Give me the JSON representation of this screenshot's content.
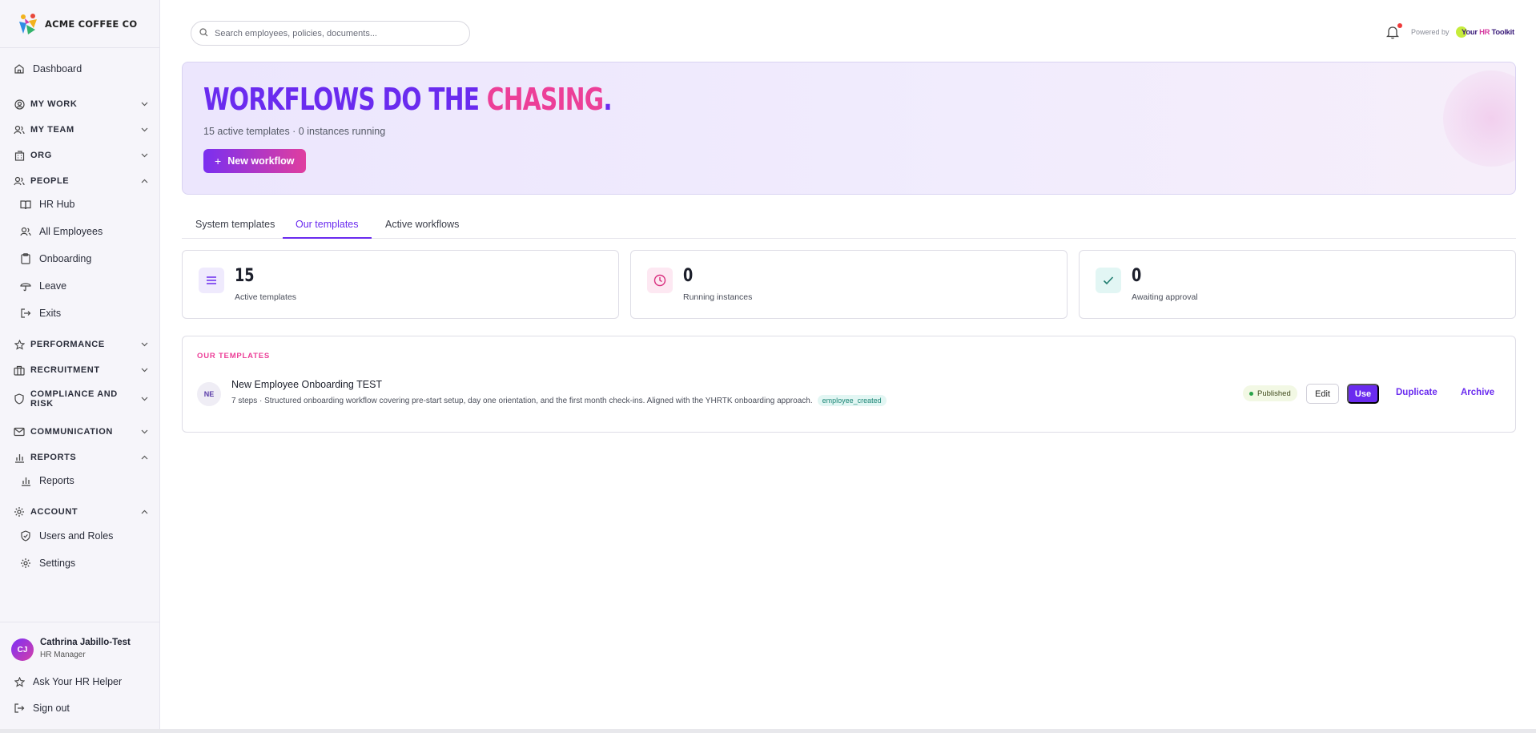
{
  "brand": {
    "name": "ACME COFFEE CO"
  },
  "sidebar": {
    "dashboard": "Dashboard",
    "sections": {
      "my_work": "MY WORK",
      "my_team": "MY TEAM",
      "org": "ORG",
      "people": "PEOPLE",
      "performance": "PERFORMANCE",
      "recruitment": "RECRUITMENT",
      "compliance": "COMPLIANCE AND RISK",
      "communication": "COMMUNICATION",
      "reports": "REPORTS",
      "account": "ACCOUNT"
    },
    "people_items": [
      "HR Hub",
      "All Employees",
      "Onboarding",
      "Leave",
      "Exits"
    ],
    "reports_items": [
      "Reports"
    ],
    "account_items": [
      "Users and Roles",
      "Settings"
    ],
    "user": {
      "initials": "CJ",
      "name": "Cathrina Jabillo-Test",
      "role": "HR Manager"
    },
    "ask_helper": "Ask Your HR Helper",
    "sign_out": "Sign out"
  },
  "topbar": {
    "search_placeholder": "Search employees, policies, documents...",
    "powered_by": "Powered by",
    "partner_logo": {
      "part1": "Your ",
      "part2": "HR",
      "part3": " Toolkit"
    }
  },
  "hero": {
    "title_main": "WORKFLOWS DO THE ",
    "title_accent": "CHASING",
    "title_end": ".",
    "subtitle": "15 active templates · 0 instances running",
    "new_button": "New workflow"
  },
  "tabs": [
    "System templates",
    "Our templates",
    "Active workflows"
  ],
  "stats": [
    {
      "value": "15",
      "label": "Active templates",
      "icon": "list-icon"
    },
    {
      "value": "0",
      "label": "Running instances",
      "icon": "clock-icon"
    },
    {
      "value": "0",
      "label": "Awaiting approval",
      "icon": "check-icon"
    }
  ],
  "templates": {
    "heading": "OUR TEMPLATES",
    "items": [
      {
        "initials": "NE",
        "name": "New Employee Onboarding TEST",
        "description": "7 steps · Structured onboarding workflow covering pre-start setup, day one orientation, and the first month check-ins. Aligned with the YHRTK onboarding approach.",
        "tag": "employee_created",
        "status": "Published",
        "actions": {
          "edit": "Edit",
          "use": "Use",
          "duplicate": "Duplicate",
          "archive": "Archive"
        }
      }
    ]
  },
  "colors": {
    "accent": "#6a2bef",
    "pink": "#ec3f98",
    "sidebar_bg": "#f6f5fa"
  }
}
